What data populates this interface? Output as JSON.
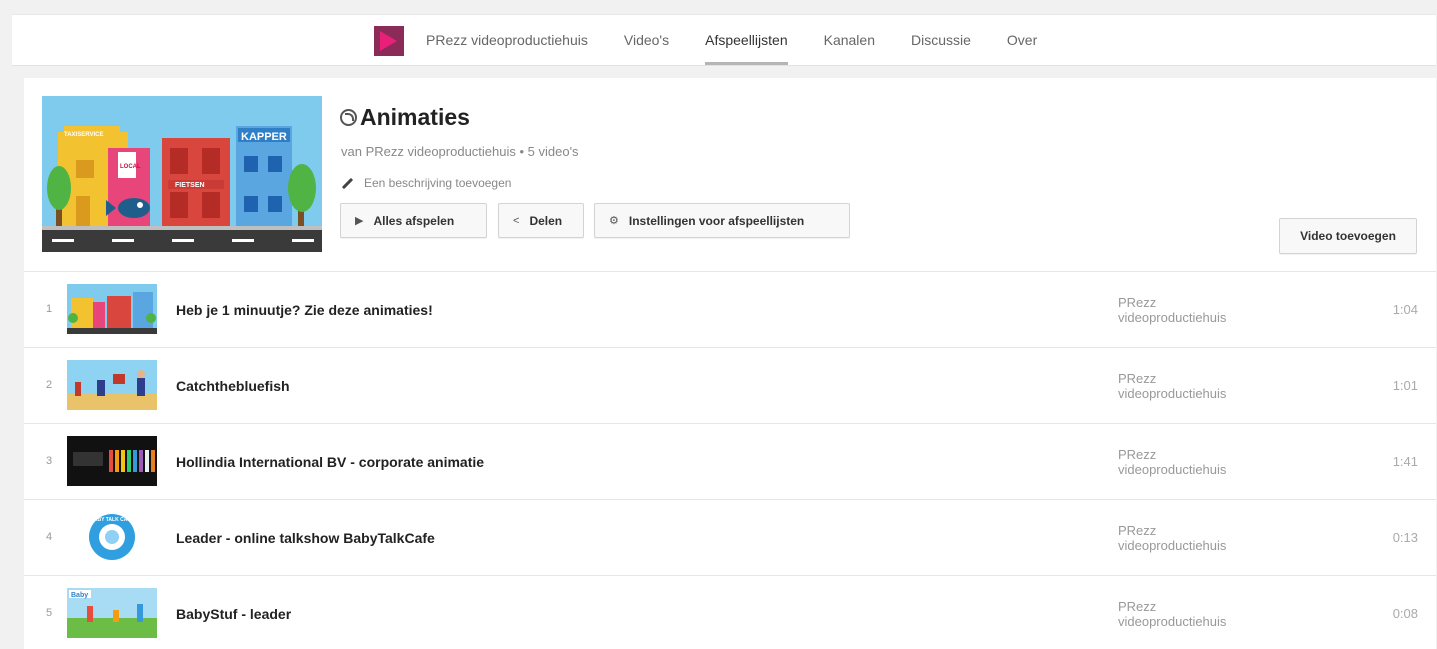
{
  "nav": {
    "channel_name": "PRezz videoproductiehuis",
    "tabs": [
      "Video's",
      "Afspeellijsten",
      "Kanalen",
      "Discussie",
      "Over"
    ],
    "active_tab": "Afspeellijsten"
  },
  "playlist": {
    "title": "Animaties",
    "byline": "van PRezz videoproductiehuis • 5 video's",
    "description_link": "Een beschrijving toevoegen",
    "buttons": {
      "play_all": "Alles afspelen",
      "share": "Delen",
      "settings": "Instellingen voor afspeellijsten",
      "add_video": "Video toevoegen"
    },
    "hero_signs": {
      "kapper": "KAPPER",
      "fietsen": "FIETSEN",
      "local": "LOCAL",
      "top_left": "TAXISERVICE"
    }
  },
  "videos": [
    {
      "index": "1",
      "title": "Heb je 1 minuutje? Zie deze animaties!",
      "owner_line1": "PRezz",
      "owner_line2": "videoproductiehuis",
      "duration": "1:04"
    },
    {
      "index": "2",
      "title": "Catchthebluefish",
      "owner_line1": "PRezz",
      "owner_line2": "videoproductiehuis",
      "duration": "1:01"
    },
    {
      "index": "3",
      "title": "Hollindia International BV - corporate animatie",
      "owner_line1": "PRezz",
      "owner_line2": "videoproductiehuis",
      "duration": "1:41"
    },
    {
      "index": "4",
      "title": "Leader - online talkshow BabyTalkCafe",
      "owner_line1": "PRezz",
      "owner_line2": "videoproductiehuis",
      "duration": "0:13"
    },
    {
      "index": "5",
      "title": "BabyStuf - leader",
      "owner_line1": "PRezz",
      "owner_line2": "videoproductiehuis",
      "duration": "0:08"
    }
  ],
  "thumb_labels": {
    "babytalk": "BABY TALK CAFE",
    "babystuf": "Baby"
  },
  "colors": {
    "brand_logo": "#8b2b57",
    "accent_pink": "#e8207a",
    "sky": "#7ecbee"
  }
}
